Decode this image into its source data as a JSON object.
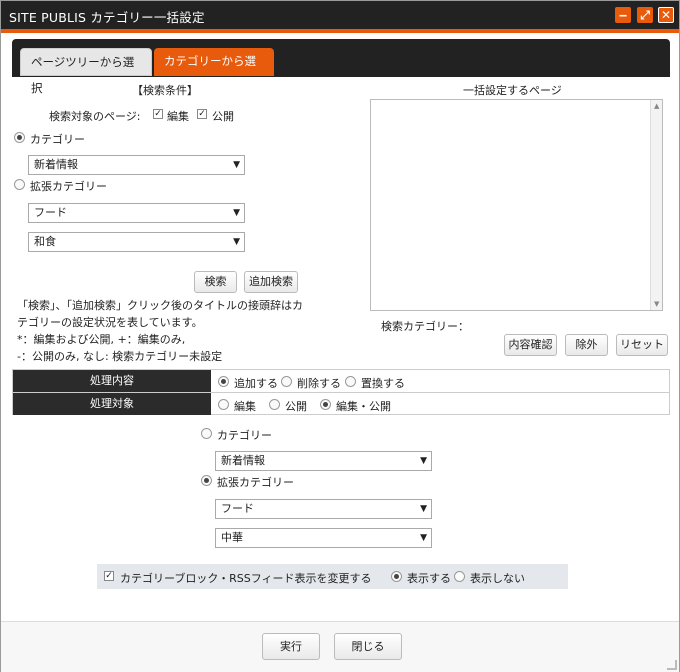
{
  "window": {
    "title": "SITE PUBLIS カテゴリー一括設定",
    "min_label": "‒",
    "max_label": "⤢",
    "close_label": "✕"
  },
  "tabs": [
    {
      "label": "ページツリーから選択",
      "active": false
    },
    {
      "label": "カテゴリーから選択",
      "active": true
    }
  ],
  "search": {
    "heading": "【検索条件】",
    "target_label": "検索対象のページ:",
    "check_edit": "編集",
    "check_public": "公開",
    "radio_category": "カテゴリー",
    "category_select": "新着情報",
    "radio_ext_category": "拡張カテゴリー",
    "ext_select1": "フード",
    "ext_select2": "和食",
    "search_button": "検索",
    "add_search_button": "追加検索",
    "note_line1": "「検索」、「追加検索」クリック後のタイトルの接頭辞はカ",
    "note_line2": "テゴリーの設定状況を表しています。",
    "note_line3": "*：編集および公開, +：編集のみ,",
    "note_line4": "-：公開のみ, なし: 検索カテゴリー未設定"
  },
  "bulk": {
    "heading": "一括設定するページ",
    "search_category_label": "検索カテゴリー：",
    "confirm_button": "内容確認",
    "remove_button": "除外",
    "reset_button": "リセット"
  },
  "process": {
    "content_header": "処理内容",
    "opt_add": "追加する",
    "opt_delete": "削除する",
    "opt_replace": "置換する",
    "target_header": "処理対象",
    "opt_edit": "編集",
    "opt_public": "公開",
    "opt_edit_public": "編集・公開"
  },
  "lower": {
    "radio_category": "カテゴリー",
    "category_select": "新着情報",
    "radio_ext_category": "拡張カテゴリー",
    "ext_select1": "フード",
    "ext_select2": "中華"
  },
  "rss": {
    "check_label": "カテゴリーブロック・RSSフィード表示を変更する",
    "opt_show": "表示する",
    "opt_hide": "表示しない"
  },
  "footer": {
    "run_button": "実行",
    "close_button": "閉じる"
  },
  "colors": {
    "accent": "#e85a0c",
    "dark": "#222222"
  }
}
